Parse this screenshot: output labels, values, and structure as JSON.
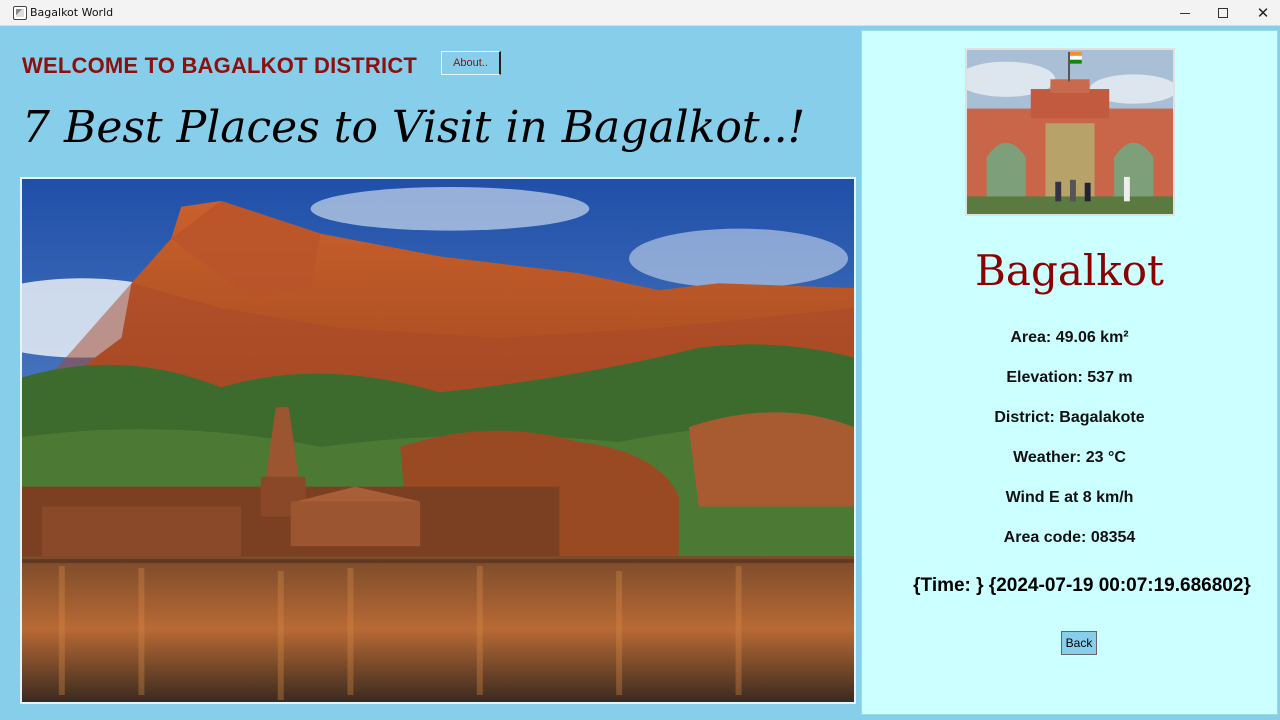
{
  "window": {
    "title": "Bagalkot World",
    "controls": {
      "minimize": "",
      "maximize": "",
      "close": "✕"
    }
  },
  "header": {
    "welcome_text": "WELCOME TO BAGALKOT DISTRICT",
    "about_label": "About.."
  },
  "main": {
    "title": "7 Best Places to Visit in Bagalkot..!"
  },
  "info": {
    "city": "Bagalkot",
    "area": "Area: 49.06 km²",
    "elevation": "Elevation: 537 m",
    "district": "District: Bagalakote",
    "weather": "Weather: 23 °C",
    "wind": "Wind E at 8 km/h",
    "area_code": "Area code: 08354",
    "time": "{Time: } {2024-07-19 00:07:19.686802}",
    "back_label": "Back"
  },
  "colors": {
    "background": "#87CEEB",
    "info_panel": "#CCFFFF",
    "accent_red": "#8B1010"
  }
}
